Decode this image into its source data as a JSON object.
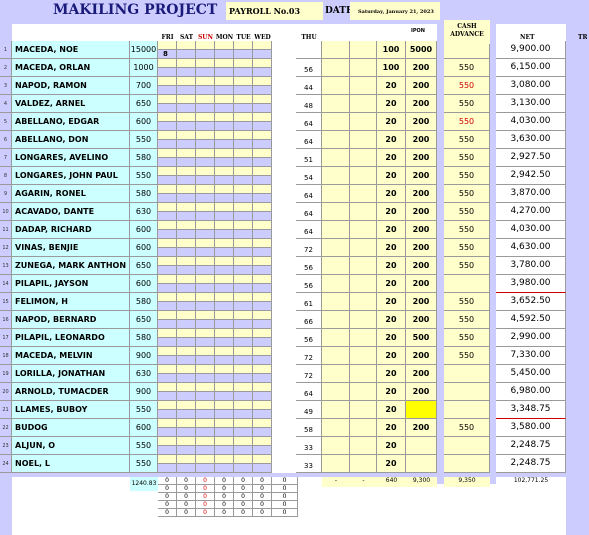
{
  "header": {
    "project_title": "MAKILING PROJECT",
    "payroll_label": "PAYROLL  No.03",
    "date_label": "DATE",
    "date_value": "Saturday, January 21, 2023",
    "ipon_label": "IPON",
    "cash_advance_label": "CASH ADVANCE",
    "net_label": "NET",
    "tr_label": "TR"
  },
  "day_columns": [
    "FRI",
    "SAT",
    "SUN",
    "MON",
    "TUE",
    "WED",
    "THU"
  ],
  "rows": [
    {
      "no": "1",
      "name": "MACEDA, NOE",
      "rate": "15000",
      "extra": "8",
      "thu": "",
      "a": "100",
      "b": "5000",
      "ca": "",
      "ca_red": false,
      "net": "9,900.00",
      "redline": false
    },
    {
      "no": "2",
      "name": "MACEDA, ORLAN",
      "rate": "1000",
      "extra": "",
      "thu": "56",
      "a": "100",
      "b": "200",
      "ca": "550",
      "ca_red": false,
      "net": "6,150.00",
      "redline": false
    },
    {
      "no": "3",
      "name": "NAPOD, RAMON",
      "rate": "700",
      "extra": "",
      "thu": "44",
      "a": "20",
      "b": "200",
      "ca": "550",
      "ca_red": true,
      "net": "3,080.00",
      "redline": false
    },
    {
      "no": "4",
      "name": "VALDEZ, ARNEL",
      "rate": "650",
      "extra": "",
      "thu": "48",
      "a": "20",
      "b": "200",
      "ca": "550",
      "ca_red": false,
      "net": "3,130.00",
      "redline": false
    },
    {
      "no": "5",
      "name": "ABELLANO, EDGAR",
      "rate": "600",
      "extra": "",
      "thu": "64",
      "a": "20",
      "b": "200",
      "ca": "550",
      "ca_red": true,
      "net": "4,030.00",
      "redline": false
    },
    {
      "no": "6",
      "name": "ABELLANO, DON",
      "rate": "550",
      "extra": "",
      "thu": "64",
      "a": "20",
      "b": "200",
      "ca": "550",
      "ca_red": false,
      "net": "3,630.00",
      "redline": false
    },
    {
      "no": "7",
      "name": "LONGARES, AVELINO",
      "rate": "580",
      "extra": "",
      "thu": "51",
      "a": "20",
      "b": "200",
      "ca": "550",
      "ca_red": false,
      "net": "2,927.50",
      "redline": false
    },
    {
      "no": "8",
      "name": "LONGARES, JOHN PAUL",
      "rate": "550",
      "extra": "",
      "thu": "54",
      "a": "20",
      "b": "200",
      "ca": "550",
      "ca_red": false,
      "net": "2,942.50",
      "redline": false
    },
    {
      "no": "9",
      "name": "AGARIN, RONEL",
      "rate": "580",
      "extra": "",
      "thu": "64",
      "a": "20",
      "b": "200",
      "ca": "550",
      "ca_red": false,
      "net": "3,870.00",
      "redline": false
    },
    {
      "no": "10",
      "name": "ACAVADO, DANTE",
      "rate": "630",
      "extra": "",
      "thu": "64",
      "a": "20",
      "b": "200",
      "ca": "550",
      "ca_red": false,
      "net": "4,270.00",
      "redline": false
    },
    {
      "no": "11",
      "name": "DADAP, RICHARD",
      "rate": "600",
      "extra": "",
      "thu": "64",
      "a": "20",
      "b": "200",
      "ca": "550",
      "ca_red": false,
      "net": "4,030.00",
      "redline": false
    },
    {
      "no": "12",
      "name": "VINAS, BENJIE",
      "rate": "600",
      "extra": "",
      "thu": "72",
      "a": "20",
      "b": "200",
      "ca": "550",
      "ca_red": false,
      "net": "4,630.00",
      "redline": false
    },
    {
      "no": "13",
      "name": "ZUNEGA, MARK ANTHON",
      "rate": "650",
      "extra": "",
      "thu": "56",
      "a": "20",
      "b": "200",
      "ca": "550",
      "ca_red": false,
      "net": "3,780.00",
      "redline": false
    },
    {
      "no": "14",
      "name": "PILAPIL, JAYSON",
      "rate": "600",
      "extra": "",
      "thu": "56",
      "a": "20",
      "b": "200",
      "ca": "",
      "ca_red": false,
      "net": "3,980.00",
      "redline": true
    },
    {
      "no": "15",
      "name": "FELIMON, H",
      "rate": "580",
      "extra": "",
      "thu": "61",
      "a": "20",
      "b": "200",
      "ca": "550",
      "ca_red": false,
      "net": "3,652.50",
      "redline": false
    },
    {
      "no": "16",
      "name": "NAPOD, BERNARD",
      "rate": "650",
      "extra": "",
      "thu": "66",
      "a": "20",
      "b": "200",
      "ca": "550",
      "ca_red": false,
      "net": "4,592.50",
      "redline": false
    },
    {
      "no": "17",
      "name": "PILAPIL, LEONARDO",
      "rate": "580",
      "extra": "",
      "thu": "56",
      "a": "20",
      "b": "500",
      "ca": "550",
      "ca_red": false,
      "net": "2,990.00",
      "redline": false
    },
    {
      "no": "18",
      "name": "MACEDA, MELVIN",
      "rate": "900",
      "extra": "",
      "thu": "72",
      "a": "20",
      "b": "200",
      "ca": "550",
      "ca_red": false,
      "net": "7,330.00",
      "redline": false
    },
    {
      "no": "19",
      "name": "LORILLA, JONATHAN",
      "rate": "630",
      "extra": "",
      "thu": "72",
      "a": "20",
      "b": "200",
      "ca": "",
      "ca_red": false,
      "net": "5,450.00",
      "redline": false
    },
    {
      "no": "20",
      "name": "ARNOLD, TUMACDER",
      "rate": "900",
      "extra": "",
      "thu": "64",
      "a": "20",
      "b": "200",
      "ca": "",
      "ca_red": false,
      "net": "6,980.00",
      "redline": false
    },
    {
      "no": "21",
      "name": "LLAMES, BUBOY",
      "rate": "550",
      "extra": "",
      "thu": "49",
      "a": "20",
      "b": "",
      "ca": "",
      "ca_red": false,
      "net": "3,348.75",
      "redline": true
    },
    {
      "no": "22",
      "name": "BUDOG",
      "rate": "600",
      "extra": "",
      "thu": "58",
      "a": "20",
      "b": "200",
      "ca": "550",
      "ca_red": false,
      "net": "3,580.00",
      "redline": false
    },
    {
      "no": "23",
      "name": "ALJUN, O",
      "rate": "550",
      "extra": "",
      "thu": "33",
      "a": "20",
      "b": "",
      "ca": "",
      "ca_red": false,
      "net": "2,248.75",
      "redline": false
    },
    {
      "no": "24",
      "name": "NOEL, L",
      "rate": "550",
      "extra": "",
      "thu": "33",
      "a": "20",
      "b": "",
      "ca": "",
      "ca_red": false,
      "net": "2,248.75",
      "redline": false
    }
  ],
  "totals": {
    "rate_total": "1240.83",
    "dash1": "-",
    "dash2": "-",
    "a_total": "640",
    "b_total": "9,300",
    "ca_total": "9,350",
    "net_total": "102,771.25",
    "zero": "0"
  },
  "colors": {
    "lavender": "#ccccff",
    "light_yellow": "#ffffcc",
    "light_cyan": "#ccffff",
    "highlight_yellow": "#ffff00",
    "title_blue": "#1a1a7a",
    "red": "#cc0000"
  }
}
